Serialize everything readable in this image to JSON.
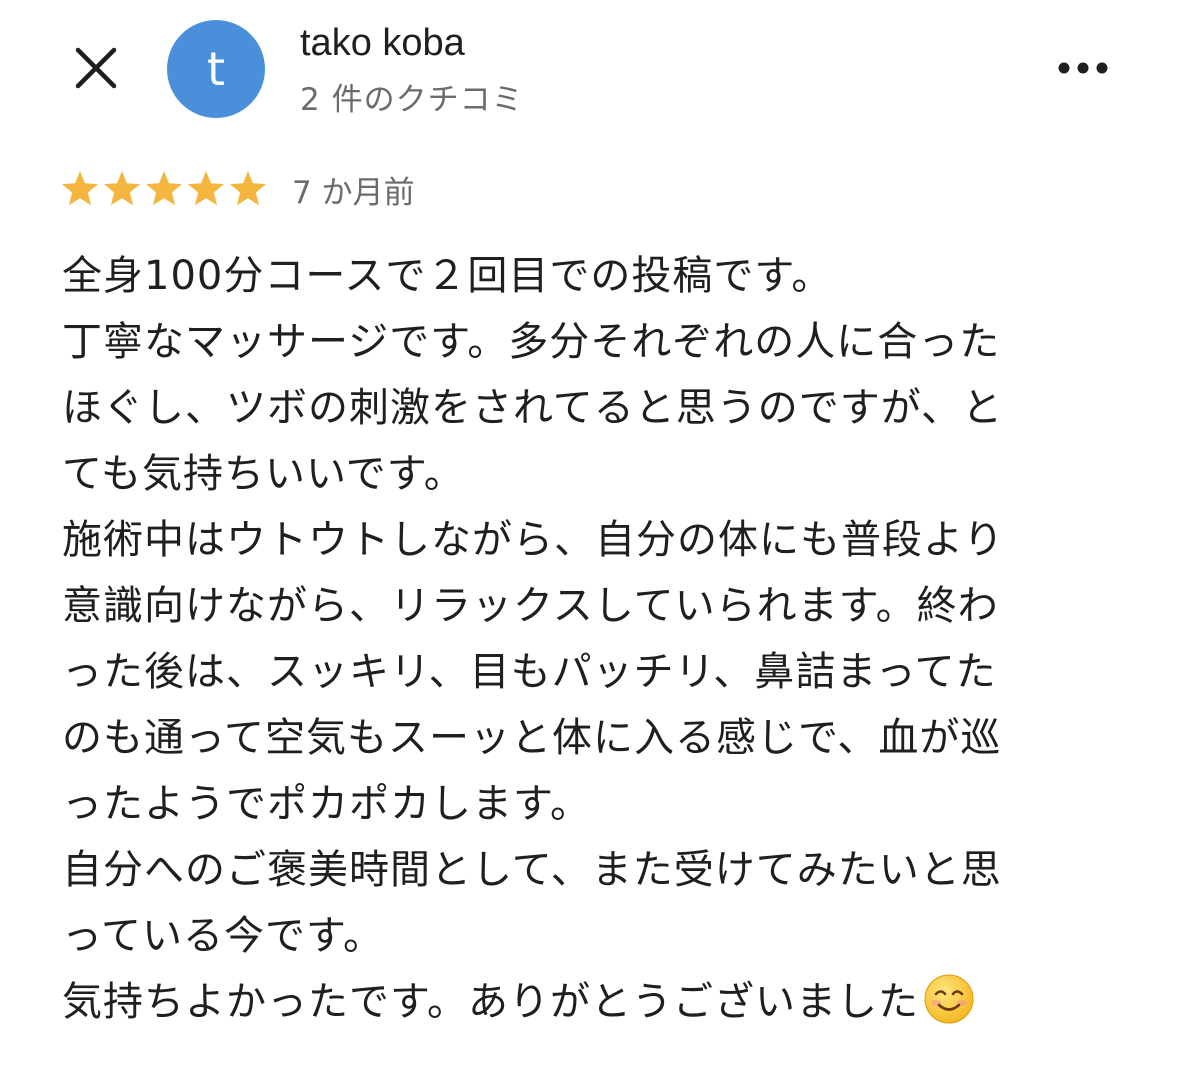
{
  "header": {
    "close_icon": "close-icon",
    "avatar_letter": "t",
    "avatar_color": "#4a8fd9",
    "author_name": "tako koba",
    "review_count": "2 件のクチコミ",
    "more_icon": "more-horizontal-icon"
  },
  "review": {
    "rating": 5,
    "rating_max": 5,
    "star_color": "#f4b63f",
    "date": "7 か月前",
    "lines": [
      "全身100分コースで２回目での投稿です。",
      "丁寧なマッサージです。多分それぞれの人に合った",
      "ほぐし、ツボの刺激をされてると思うのですが、と",
      "ても気持ちいいです。",
      "施術中はウトウトしながら、自分の体にも普段より",
      "意識向けながら、リラックスしていられます。終わ",
      "った後は、スッキリ、目もパッチリ、鼻詰まってた",
      "のも通って空気もスーッと体に入る感じで、血が巡",
      "ったようでポカポカします。",
      "自分へのご褒美時間として、また受けてみたいと思",
      "っている今です。",
      "気持ちよかったです。ありがとうございました"
    ],
    "trailing_emoji": "smiling-face-emoji"
  }
}
